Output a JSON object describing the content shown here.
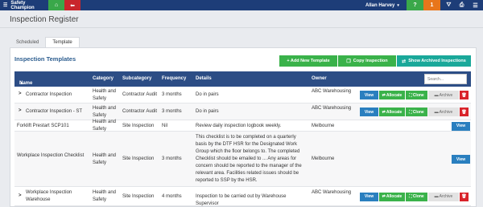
{
  "app": {
    "name": "Safety Champion",
    "user": "Allan Harvey"
  },
  "topbar": {
    "home_icon": "home-icon",
    "back_icon": "back-arrow-icon",
    "help": "?",
    "notifications": "1",
    "colors": {
      "bar": "#1d3d78",
      "home": "#3aa84a",
      "back": "#c9262c",
      "help": "#3aa84a",
      "notif": "#e8761b"
    }
  },
  "page": {
    "title": "Inspection Register"
  },
  "tabs": [
    {
      "label": "Scheduled"
    },
    {
      "label": "Template"
    }
  ],
  "panel": {
    "title": "Inspection Templates",
    "actions": {
      "new": "+ Add New Template",
      "copy": "Copy Inspection",
      "archived": "Show Archived Inspections"
    }
  },
  "table": {
    "columns": [
      "Name",
      "Category",
      "Subcategory",
      "Frequency",
      "Details",
      "Owner"
    ],
    "search_placeholder": "Search...",
    "buttons": {
      "view": "View",
      "allocate": "Allocate",
      "clone": "Clone",
      "archive": "Archive"
    },
    "rows": [
      {
        "name": "Contractor Inspection",
        "category": "Health and Safety",
        "subcategory": "Contractor Audit",
        "frequency": "3 months",
        "details": "Do in pairs",
        "owner": "ABC Warehousing",
        "expandable": true,
        "actions": "full"
      },
      {
        "name": "Contractor Inspection - ST",
        "category": "Health and Safety",
        "subcategory": "Contractor Audit",
        "frequency": "3 months",
        "details": "Do in pairs",
        "owner": "ABC Warehousing",
        "expandable": true,
        "actions": "full"
      },
      {
        "name": "Forklift Prestart SCP101",
        "category": "Health and Safety",
        "subcategory": "Site Inspection",
        "frequency": "Nil",
        "details": "Review daily inspection logbook weekly.",
        "owner": "Melbourne",
        "expandable": false,
        "actions": "view"
      },
      {
        "name": "Workplace Inspection Checklist",
        "category": "Health and Safety",
        "subcategory": "Site Inspection",
        "frequency": "3 months",
        "details": "This checklist is to be completed on a quarterly basis by the DTF HSR for the Designated Work Group which the floor belongs to. The completed Checklist should be emailed to ... Any areas for concern should be reported to the manager of the relevant area. Facilities related issues should be reported to SSP by the HSR.",
        "owner": "Melbourne",
        "expandable": false,
        "actions": "view"
      },
      {
        "name": "Workplace Inspection Warehouse",
        "category": "Health and Safety",
        "subcategory": "Site Inspection",
        "frequency": "4 months",
        "details": "Inspection to be carried out by Warehouse Supervisor",
        "owner": "ABC Warehousing",
        "expandable": true,
        "actions": "full"
      }
    ]
  }
}
